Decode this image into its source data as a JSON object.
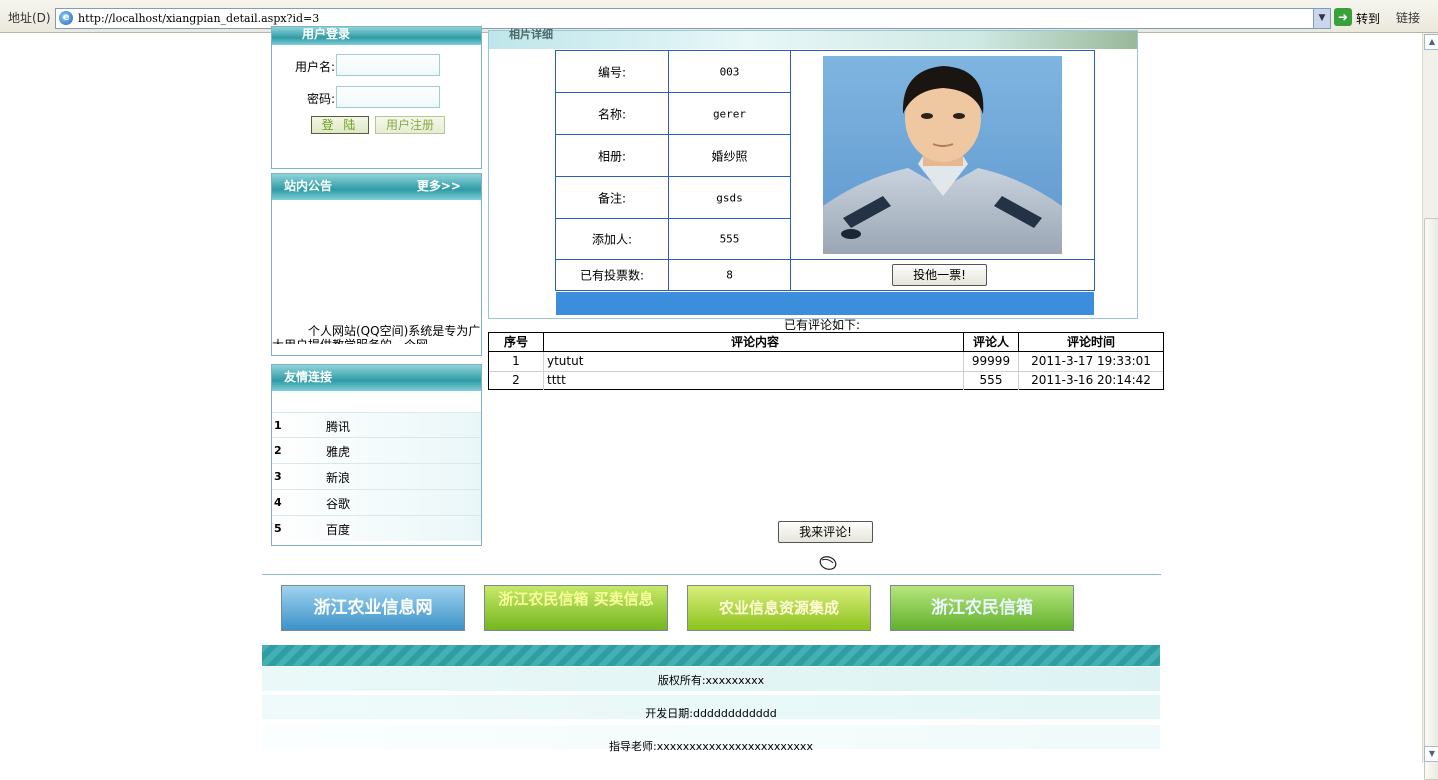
{
  "browser": {
    "address_label": "地址(D)",
    "url": "http://localhost/xiangpian_detail.aspx?id=3",
    "go_label": "转到",
    "links_label": "链接"
  },
  "sidebar": {
    "login": {
      "title": "用户登录",
      "username_label": "用户名:",
      "password_label": "密码:",
      "login_button": "登 陆",
      "register_button": "用户注册"
    },
    "notice": {
      "title": "站内公告",
      "more": "更多>>",
      "body": "个人网站(QQ空间)系统是专为广大用户提供教学服务的一个网"
    },
    "friend_links": {
      "title": "友情连接",
      "items": [
        {
          "num": "1",
          "name": "腾讯"
        },
        {
          "num": "2",
          "name": "雅虎"
        },
        {
          "num": "3",
          "name": "新浪"
        },
        {
          "num": "4",
          "name": "谷歌"
        },
        {
          "num": "5",
          "name": "百度"
        }
      ]
    }
  },
  "detail": {
    "section_title": "相片详细",
    "fields": {
      "id_label": "编号:",
      "id_value": "003",
      "name_label": "名称:",
      "name_value": "gerer",
      "album_label": "相册:",
      "album_value": "婚纱照",
      "remark_label": "备注:",
      "remark_value": "gsds",
      "adder_label": "添加人:",
      "adder_value": "555",
      "votes_label": "已有投票数:",
      "votes_value": "8"
    },
    "vote_button": "投他一票!"
  },
  "comments": {
    "title": "已有评论如下:",
    "headers": [
      "序号",
      "评论内容",
      "评论人",
      "评论时间"
    ],
    "rows": [
      [
        "1",
        "ytutut",
        "99999",
        "2011-3-17 19:33:01"
      ],
      [
        "2",
        "tttt",
        "555",
        "2011-3-16 20:14:42"
      ]
    ],
    "comment_button": "我来评论!"
  },
  "footer": {
    "banners": [
      "浙江农业信息网",
      "浙江农民信箱 买卖信息",
      "农业信息资源集成",
      "浙江农民信箱"
    ],
    "copyright": "版权所有:xxxxxxxxx",
    "dev_date": "开发日期:dddddddddddd",
    "teacher": "指导老师:xxxxxxxxxxxxxxxxxxxxxxxx"
  }
}
